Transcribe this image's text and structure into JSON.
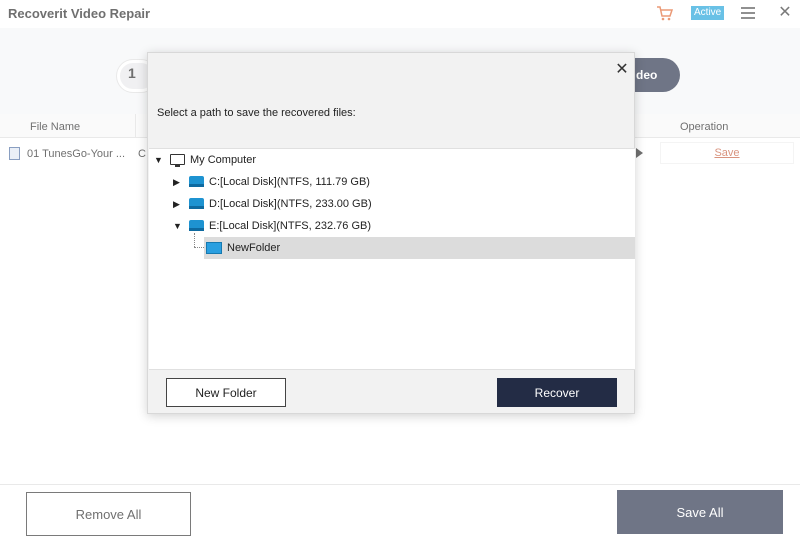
{
  "app": {
    "title": "Recoverit Video Repair",
    "badge": "Active",
    "accent_color": "#232c45",
    "badge_color": "#19a0d9"
  },
  "steps": {
    "step_number": "1",
    "dark_step_label": "deo"
  },
  "table": {
    "headers": {
      "file_name": "File Name",
      "operation": "Operation"
    },
    "rows": [
      {
        "file_name": "01 TunesGo-Your ...",
        "extra": "C",
        "operation": "Save"
      }
    ]
  },
  "dialog": {
    "prompt": "Select a path to save the recovered files:",
    "tree": {
      "root": "My Computer",
      "drives": [
        {
          "label": "C:[Local Disk](NTFS, 111.79  GB)",
          "expanded": false
        },
        {
          "label": "D:[Local Disk](NTFS, 233.00  GB)",
          "expanded": false
        },
        {
          "label": "E:[Local Disk](NTFS, 232.76  GB)",
          "expanded": true
        }
      ],
      "child_folder": "NewFolder"
    },
    "new_folder_label": "New Folder",
    "recover_label": "Recover"
  },
  "footer": {
    "remove_all_label": "Remove All",
    "save_all_label": "Save All"
  }
}
